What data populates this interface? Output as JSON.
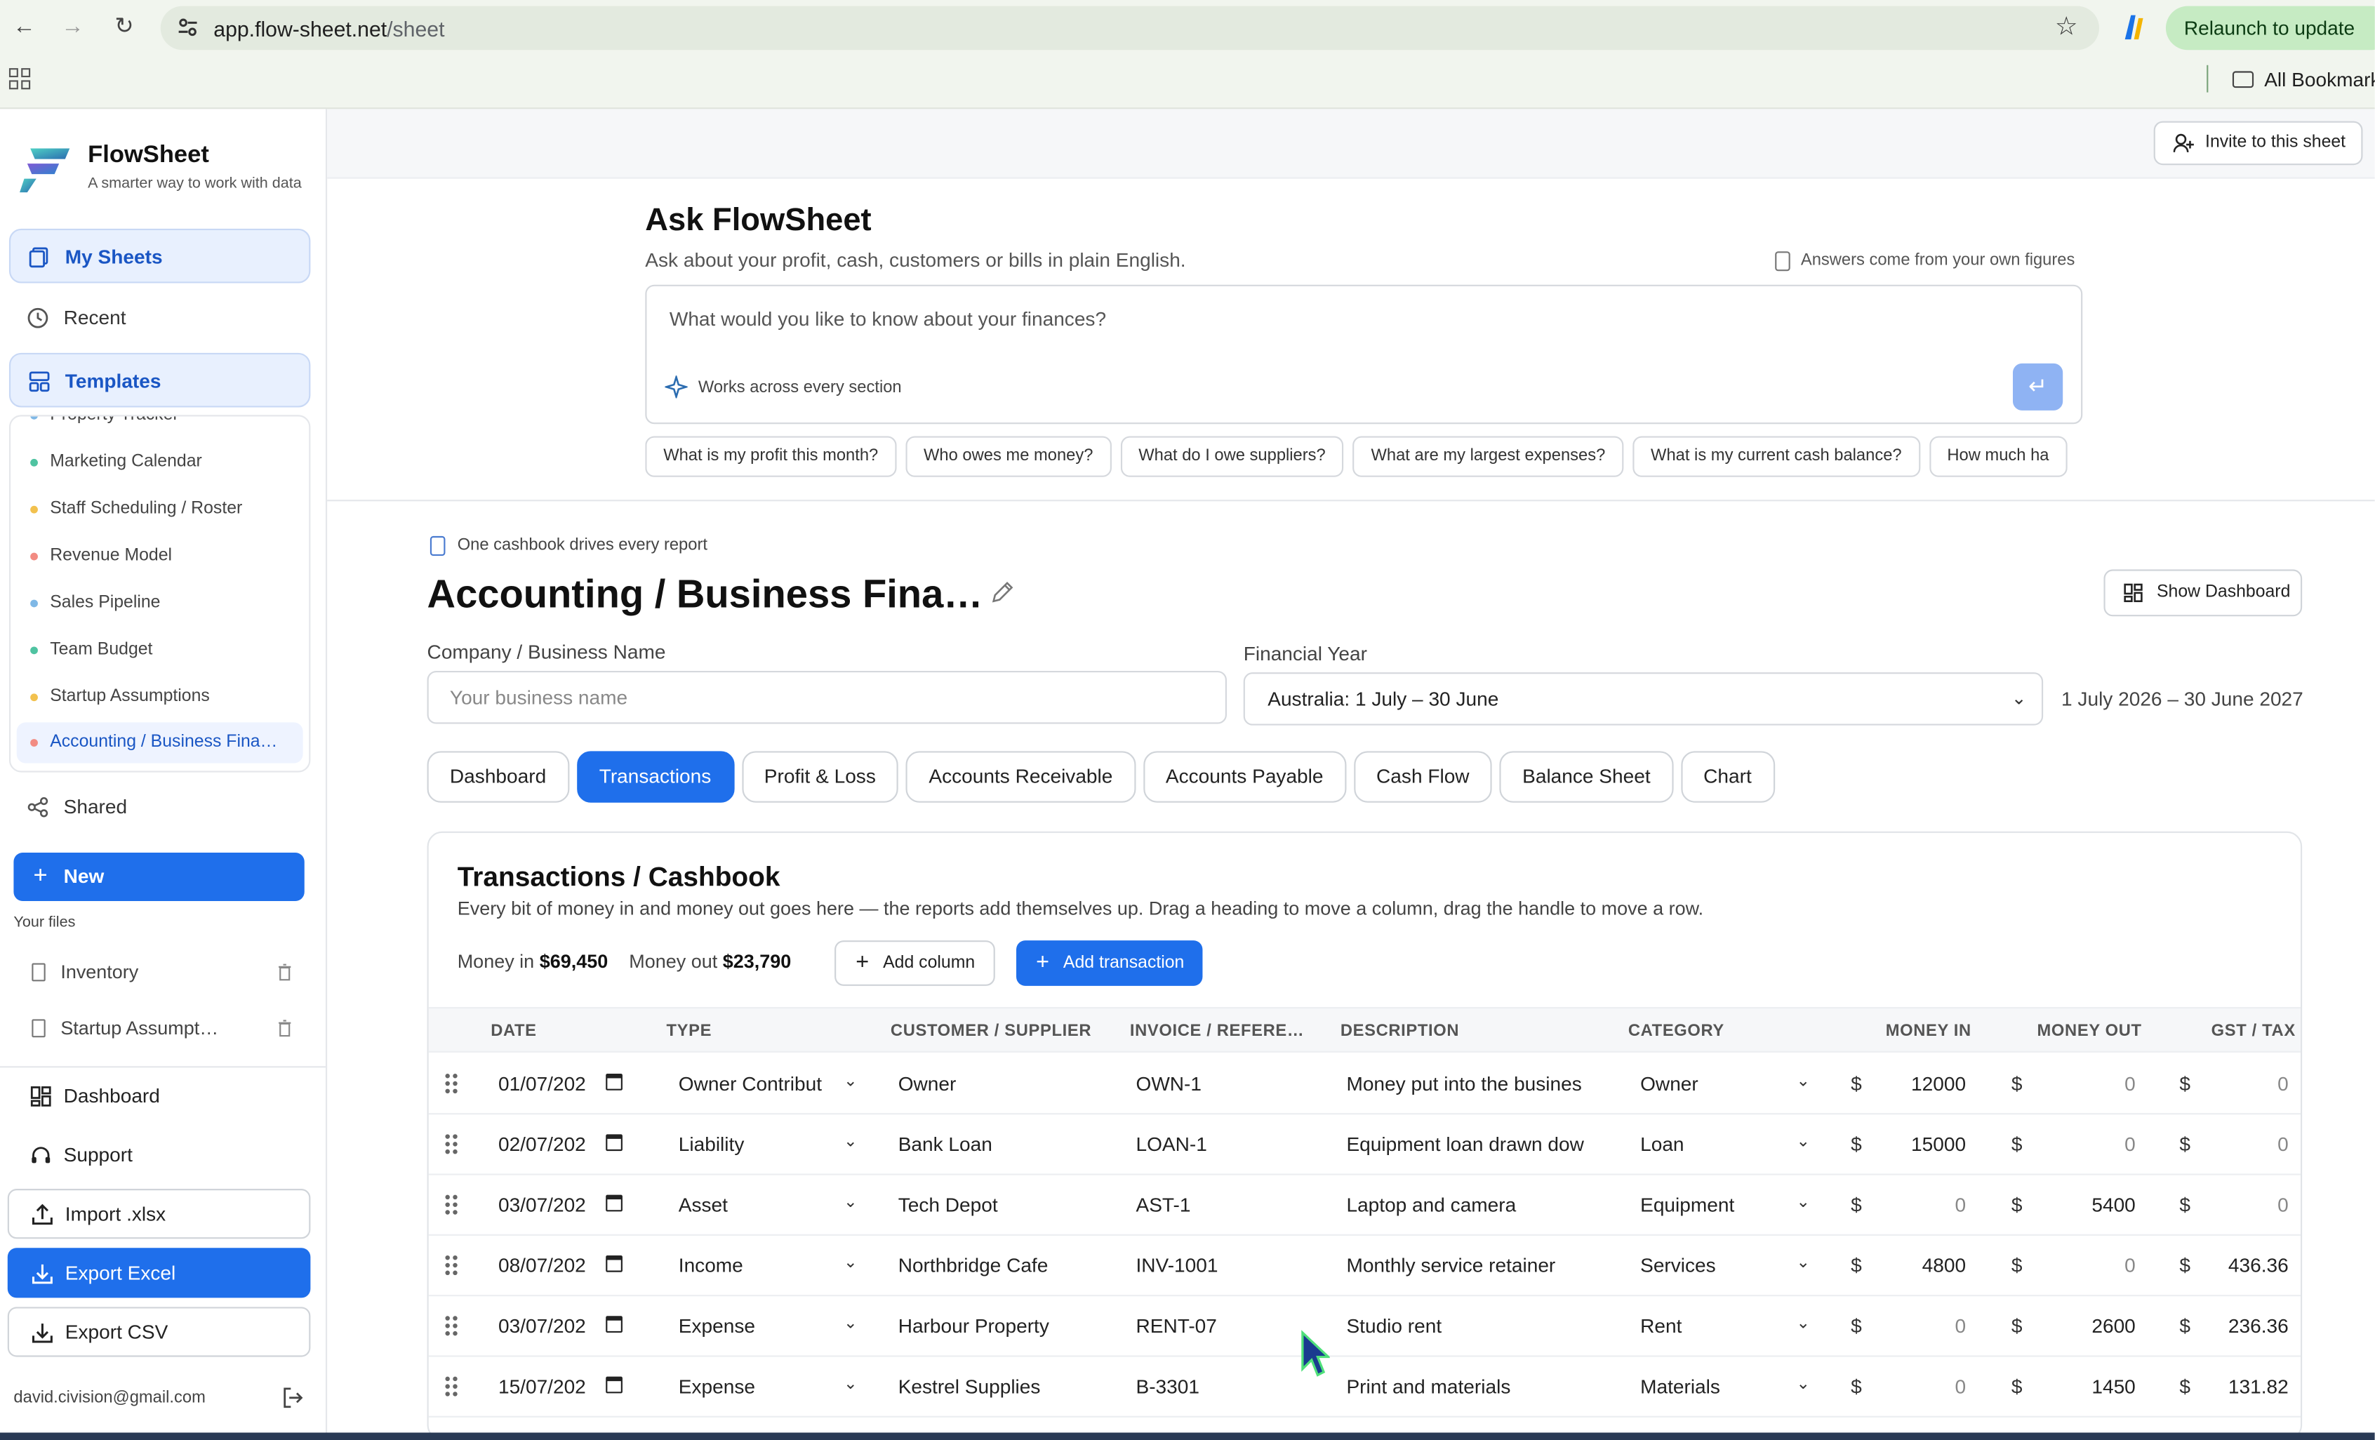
{
  "browser": {
    "url_host": "app.flow-sheet.net",
    "url_path": "/sheet",
    "relaunch_label": "Relaunch to update",
    "bookmarks_label": "All Bookmarks"
  },
  "sidebar": {
    "brand_name": "FlowSheet",
    "brand_tagline": "A smarter way to work with data",
    "nav": {
      "my_sheets": "My Sheets",
      "recent": "Recent",
      "templates": "Templates",
      "shared": "Shared"
    },
    "templates": [
      {
        "label": "Property Tracker",
        "dot": "#7fb8e6"
      },
      {
        "label": "Marketing Calendar",
        "dot": "#4fc3a1"
      },
      {
        "label": "Staff Scheduling / Roster",
        "dot": "#f2c14e"
      },
      {
        "label": "Revenue Model",
        "dot": "#f28b82"
      },
      {
        "label": "Sales Pipeline",
        "dot": "#7fb8e6"
      },
      {
        "label": "Team Budget",
        "dot": "#4fc3a1"
      },
      {
        "label": "Startup Assumptions",
        "dot": "#f2c14e"
      },
      {
        "label": "Accounting / Business Fina…",
        "dot": "#f28b82"
      }
    ],
    "new_label": "New",
    "your_files_label": "Your files",
    "files": [
      "Inventory",
      "Startup Assumpt…"
    ],
    "dashboard_label": "Dashboard",
    "support_label": "Support",
    "import_label": "Import .xlsx",
    "export_excel_label": "Export Excel",
    "export_csv_label": "Export CSV",
    "user_email": "david.civision@gmail.com"
  },
  "topbar": {
    "invite_label": "Invite to this sheet"
  },
  "ask": {
    "title": "Ask FlowSheet",
    "subtitle": "Ask about your profit, cash, customers or bills in plain English.",
    "note": "Answers come from your own figures",
    "placeholder": "What would you like to know about your finances?",
    "hint": "Works across every section",
    "suggestions": [
      "What is my profit this month?",
      "Who owes me money?",
      "What do I owe suppliers?",
      "What are my largest expenses?",
      "What is my current cash balance?",
      "How much ha"
    ]
  },
  "sheet": {
    "eyebrow": "One cashbook drives every report",
    "title": "Accounting / Business Fina…",
    "show_dashboard_label": "Show Dashboard",
    "company_label": "Company / Business Name",
    "company_placeholder": "Your business name",
    "fy_label": "Financial Year",
    "fy_value": "Australia: 1 July – 30 June",
    "fy_range": "1 July 2026 – 30 June 2027",
    "tabs": [
      "Dashboard",
      "Transactions",
      "Profit & Loss",
      "Accounts Receivable",
      "Accounts Payable",
      "Cash Flow",
      "Balance Sheet",
      "Chart"
    ],
    "active_tab": "Transactions"
  },
  "cashbook": {
    "title": "Transactions / Cashbook",
    "subtitle": "Every bit of money in and money out goes here — the reports add themselves up. Drag a heading to move a column, drag the handle to move a row.",
    "money_in_label": "Money in",
    "money_in_value": "$69,450",
    "money_out_label": "Money out",
    "money_out_value": "$23,790",
    "add_column_label": "Add column",
    "add_transaction_label": "Add transaction",
    "currency_symbol": "$",
    "columns": [
      "DATE",
      "TYPE",
      "CUSTOMER / SUPPLIER",
      "INVOICE / REFERE…",
      "DESCRIPTION",
      "CATEGORY",
      "MONEY IN",
      "MONEY OUT",
      "GST / TAX"
    ],
    "rows": [
      {
        "date": "01/07/202",
        "type": "Owner Contribut",
        "party": "Owner",
        "ref": "OWN-1",
        "desc": "Money put into the busines",
        "category": "Owner",
        "money_in": "12000",
        "money_out": "0",
        "gst": "0"
      },
      {
        "date": "02/07/202",
        "type": "Liability",
        "party": "Bank Loan",
        "ref": "LOAN-1",
        "desc": "Equipment loan drawn dow",
        "category": "Loan",
        "money_in": "15000",
        "money_out": "0",
        "gst": "0"
      },
      {
        "date": "03/07/202",
        "type": "Asset",
        "party": "Tech Depot",
        "ref": "AST-1",
        "desc": "Laptop and camera",
        "category": "Equipment",
        "money_in": "0",
        "money_out": "5400",
        "gst": "0"
      },
      {
        "date": "08/07/202",
        "type": "Income",
        "party": "Northbridge Cafe",
        "ref": "INV-1001",
        "desc": "Monthly service retainer",
        "category": "Services",
        "money_in": "4800",
        "money_out": "0",
        "gst": "436.36"
      },
      {
        "date": "03/07/202",
        "type": "Expense",
        "party": "Harbour Property",
        "ref": "RENT-07",
        "desc": "Studio rent",
        "category": "Rent",
        "money_in": "0",
        "money_out": "2600",
        "gst": "236.36"
      },
      {
        "date": "15/07/202",
        "type": "Expense",
        "party": "Kestrel Supplies",
        "ref": "B-3301",
        "desc": "Print and materials",
        "category": "Materials",
        "money_in": "0",
        "money_out": "1450",
        "gst": "131.82"
      }
    ]
  },
  "colors": {
    "accent": "#1f6feb",
    "active_nav_bg": "#e8f0fe",
    "relaunch_bg": "#c6ebc3"
  }
}
